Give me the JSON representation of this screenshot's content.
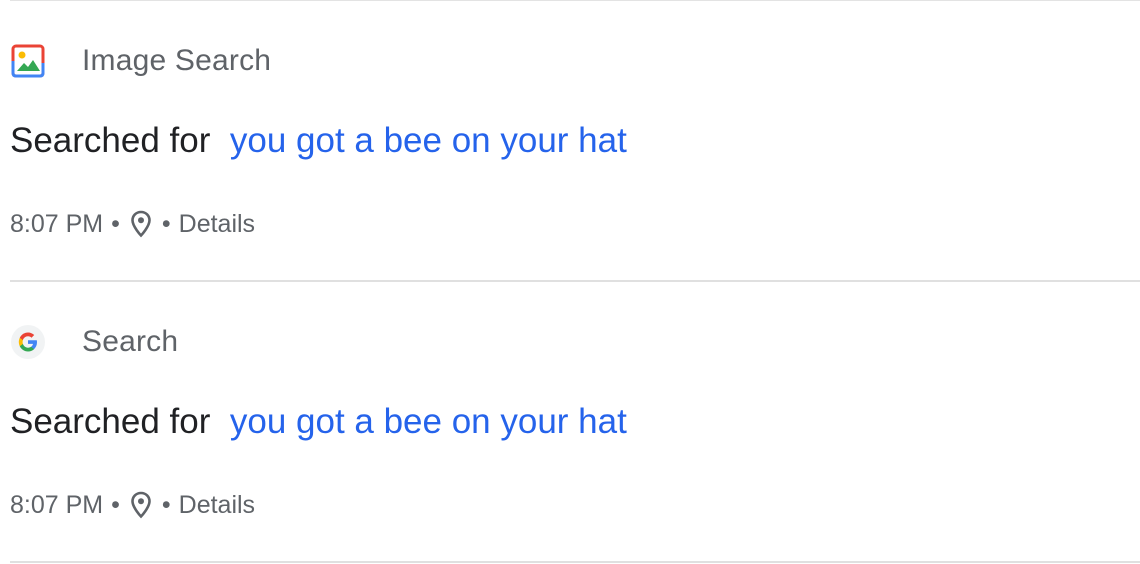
{
  "entries": [
    {
      "product": "Image Search",
      "product_icon": "image-search-icon",
      "prefix": "Searched for",
      "query": "you got a bee on your hat",
      "time": "8:07 PM",
      "separator": "•",
      "location_icon": "location-pin-icon",
      "details": "Details"
    },
    {
      "product": "Search",
      "product_icon": "google-g-icon",
      "prefix": "Searched for",
      "query": "you got a bee on your hat",
      "time": "8:07 PM",
      "separator": "•",
      "location_icon": "location-pin-icon",
      "details": "Details"
    }
  ],
  "colors": {
    "link": "#2563eb",
    "text_primary": "#202124",
    "text_secondary": "#5f6368",
    "divider": "#e0e0e0"
  }
}
